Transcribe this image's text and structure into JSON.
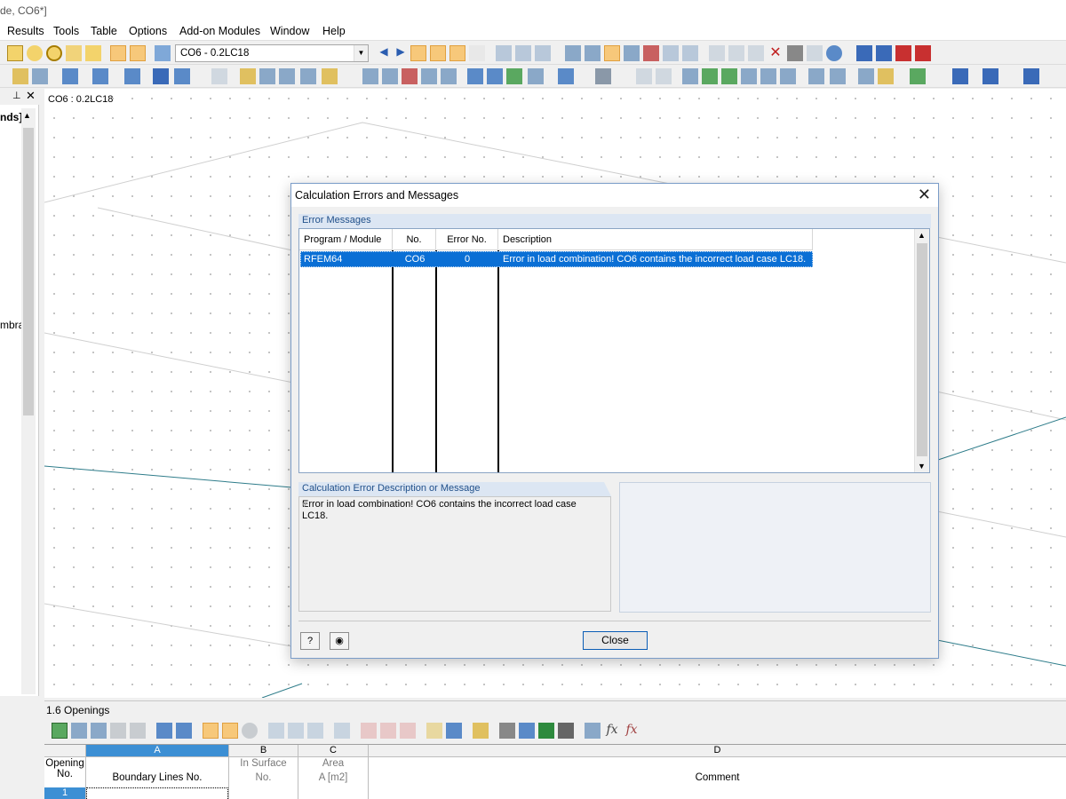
{
  "window": {
    "title_fragment": "de, CO6*]"
  },
  "menu": [
    "Results",
    "Tools",
    "Table",
    "Options",
    "Add-on Modules",
    "Window",
    "Help"
  ],
  "toolbar": {
    "load_combo": "CO6 - 0.2LC18"
  },
  "left_panel": {
    "text_top": "nds]",
    "text_mid": "mbra"
  },
  "viewport": {
    "label": "CO6 : 0.2LC18"
  },
  "dialog": {
    "title": "Calculation Errors and Messages",
    "error_group_label": "Error Messages",
    "columns": [
      "Program / Module",
      "No.",
      "Error No.",
      "Description"
    ],
    "rows": [
      {
        "module": "RFEM64",
        "no": "CO6",
        "error_no": "0",
        "description": "Error in load combination! CO6 contains the incorrect load case LC18."
      }
    ],
    "desc_group_label": "Calculation Error Description or Message",
    "desc_text": "Error in load combination! CO6 contains the incorrect load case LC18.",
    "close_label": "Close"
  },
  "table_panel": {
    "title": "1.6 Openings",
    "columns": [
      {
        "letter": "",
        "line1": "Opening",
        "line2": "No."
      },
      {
        "letter": "A",
        "line1": "",
        "line2": "Boundary Lines No."
      },
      {
        "letter": "B",
        "line1": "In Surface",
        "line2": "No."
      },
      {
        "letter": "C",
        "line1": "Area",
        "line2": "A [m2]"
      },
      {
        "letter": "D",
        "line1": "",
        "line2": "Comment"
      }
    ],
    "first_row_no": "1"
  }
}
